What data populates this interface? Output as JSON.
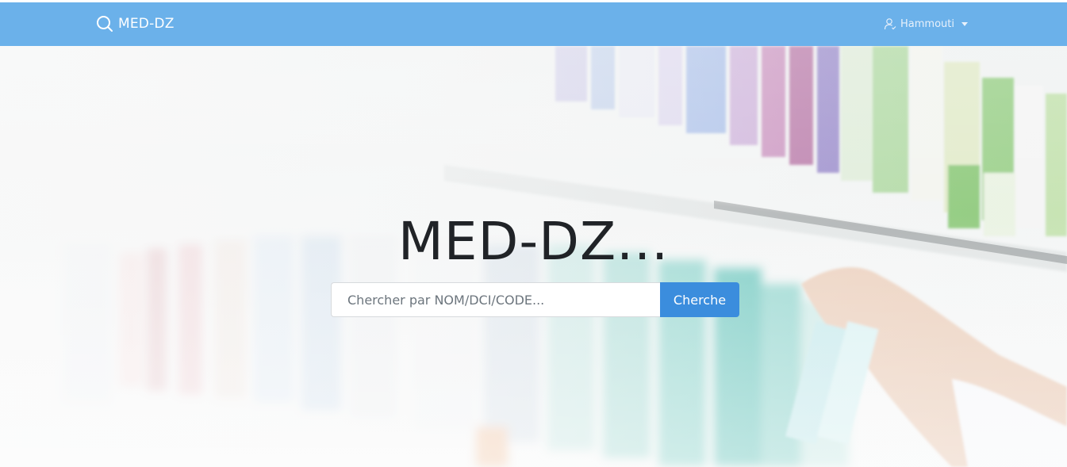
{
  "navbar": {
    "brand_label": "MED-DZ",
    "brand_icon": "search-icon",
    "user_icon": "user-icon",
    "user_name": "Hammouti",
    "background_color": "#6bb1ea"
  },
  "hero": {
    "title": "MED-DZ...",
    "search": {
      "placeholder": "Chercher par NOM/DCI/CODE...",
      "value": "",
      "button_label": "Cherche",
      "button_color": "#3b8ddd"
    }
  }
}
